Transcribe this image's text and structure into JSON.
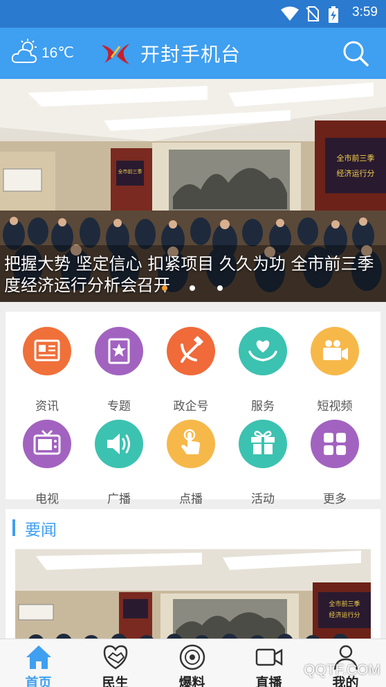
{
  "status_bar": {
    "time": "3:59"
  },
  "header": {
    "temperature": "16℃",
    "title": "开封手机台",
    "weather_icon": "cloud-sun-icon",
    "search_icon": "search-icon"
  },
  "banner": {
    "caption": "把握大势 坚定信心 扣紧项目 久久为功 全市前三季度经济运行分析会召开",
    "screen_text": "全市前三季度经济运行分析会"
  },
  "grid": [
    {
      "label": "资讯",
      "icon": "newspaper-icon",
      "color": "#f0703a"
    },
    {
      "label": "专题",
      "icon": "star-icon",
      "color": "#a263c0"
    },
    {
      "label": "政企号",
      "icon": "hammer-sickle-icon",
      "color": "#f06a3a"
    },
    {
      "label": "服务",
      "icon": "heart-hands-icon",
      "color": "#3cc2b0"
    },
    {
      "label": "短视频",
      "icon": "video-camera-icon",
      "color": "#f7b84a"
    },
    {
      "label": "电视",
      "icon": "tv-icon",
      "color": "#a263c0"
    },
    {
      "label": "广播",
      "icon": "speaker-icon",
      "color": "#3cc2b0"
    },
    {
      "label": "点播",
      "icon": "tap-icon",
      "color": "#f7b84a"
    },
    {
      "label": "活动",
      "icon": "gift-icon",
      "color": "#3cc2b0"
    },
    {
      "label": "更多",
      "icon": "grid-more-icon",
      "color": "#a263c0"
    }
  ],
  "news": {
    "section_title": "要闻"
  },
  "bottom_nav": [
    {
      "label": "首页",
      "icon": "home-icon",
      "active": true
    },
    {
      "label": "民生",
      "icon": "handshake-icon",
      "active": false
    },
    {
      "label": "爆料",
      "icon": "disc-icon",
      "active": false
    },
    {
      "label": "直播",
      "icon": "live-camera-icon",
      "active": false
    },
    {
      "label": "我的",
      "icon": "person-icon",
      "active": false
    }
  ],
  "watermark": "QQTF.COM",
  "colors": {
    "header": "#3f9ff0",
    "status_bar": "#2a7ad0",
    "accent": "#3f9ff0"
  }
}
